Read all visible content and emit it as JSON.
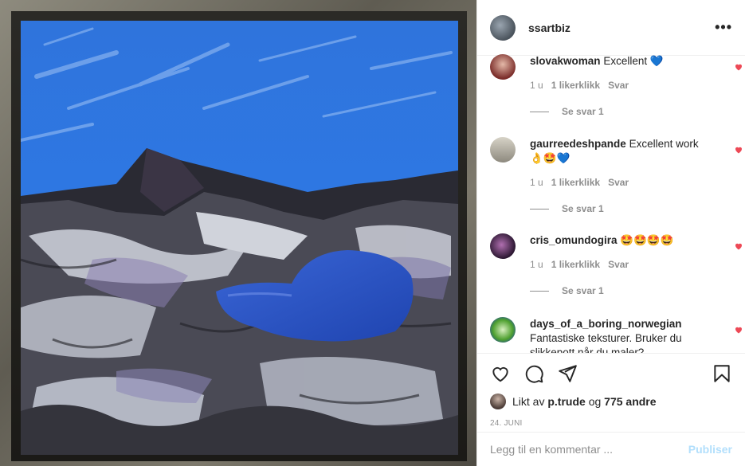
{
  "post": {
    "username": "ssartbiz",
    "more_icon": "more-horizontal-icon",
    "artwork_colors": {
      "sky": "#2a6fd6",
      "lake": "#2e55c8",
      "rock": "#3a3a44",
      "snow": "#d8dbe2"
    }
  },
  "comments": [
    {
      "user": "slovakwoman",
      "text": "Excellent 💙",
      "age": "1 u",
      "likes": "1 likerklikk",
      "reply": "Svar",
      "replies": "Se svar 1"
    },
    {
      "user": "gaurreedeshpande",
      "text": "Excellent work 👌🤩💙",
      "age": "1 u",
      "likes": "1 likerklikk",
      "reply": "Svar",
      "replies": "Se svar 1"
    },
    {
      "user": "cris_omundogira",
      "text": "🤩🤩🤩🤩",
      "age": "1 u",
      "likes": "1 likerklikk",
      "reply": "Svar",
      "replies": "Se svar 1"
    },
    {
      "user": "days_of_a_boring_norwegian",
      "text": "Fantastiske teksturer. Bruker du slikkepott når du maler?"
    }
  ],
  "likes": {
    "prefix": "Likt av",
    "user": "p.trude",
    "joiner": "og",
    "others": "775 andre"
  },
  "date": "24. JUNI",
  "composer": {
    "placeholder": "Legg til en kommentar ...",
    "publish": "Publiser"
  },
  "colors": {
    "heart": "#ed4956",
    "publish_disabled": "#b2dffc"
  }
}
